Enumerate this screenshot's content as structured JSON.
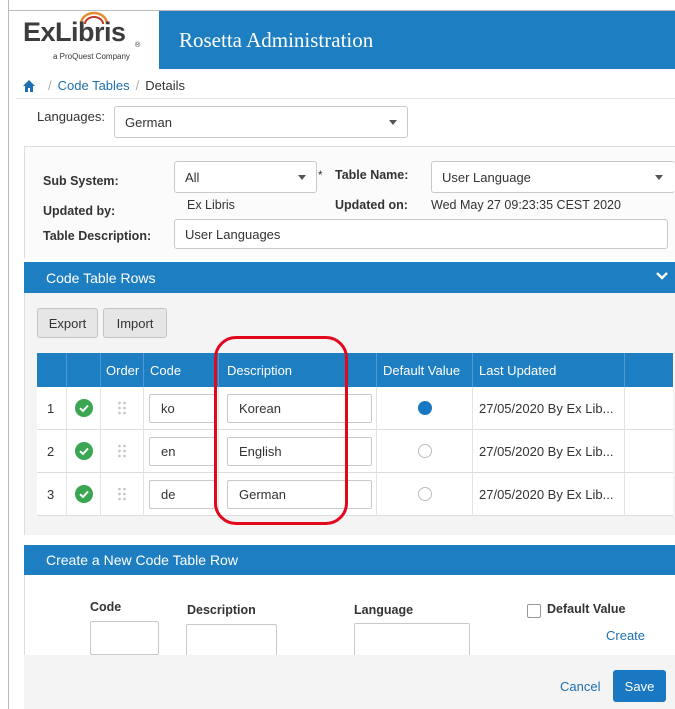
{
  "header": {
    "logo_text": "ExLibris",
    "logo_subtitle": "a ProQuest Company",
    "app_title": "Rosetta Administration",
    "color": "#1d7fc1"
  },
  "breadcrumb": {
    "home_icon": "home-icon",
    "items": [
      "Code Tables",
      "Details"
    ]
  },
  "languages": {
    "label": "Languages:",
    "selected": "German"
  },
  "details": {
    "sub_system_label": "Sub System:",
    "sub_system_value": "All",
    "table_name_label": "Table Name:",
    "table_name_value": "User Language",
    "updated_by_label": "Updated by:",
    "updated_by_value": "Ex Libris",
    "updated_on_label": "Updated on:",
    "updated_on_value": "Wed May 27 09:23:35 CEST 2020",
    "table_description_label": "Table Description:",
    "table_description_value": "User Languages",
    "required_marker": "*"
  },
  "code_table_rows": {
    "title": "Code Table Rows",
    "export_label": "Export",
    "import_label": "Import",
    "columns": [
      "Order",
      "Code",
      "Description",
      "Default Value",
      "Last Updated"
    ],
    "rows": [
      {
        "num": "1",
        "code": "ko",
        "description": "Korean",
        "default": true,
        "last_updated": "27/05/2020  By Ex Lib..."
      },
      {
        "num": "2",
        "code": "en",
        "description": "English",
        "default": false,
        "last_updated": "27/05/2020  By Ex Lib..."
      },
      {
        "num": "3",
        "code": "de",
        "description": "German",
        "default": false,
        "last_updated": "27/05/2020  By Ex Lib..."
      }
    ]
  },
  "create_row": {
    "title": "Create a New Code Table Row",
    "code_label": "Code",
    "description_label": "Description",
    "language_label": "Language",
    "default_value_label": "Default Value",
    "create_label": "Create"
  },
  "footer": {
    "cancel_label": "Cancel",
    "save_label": "Save"
  },
  "colors": {
    "accent": "#1d7fc1",
    "check": "#3aa651",
    "highlight": "#e3071c"
  }
}
